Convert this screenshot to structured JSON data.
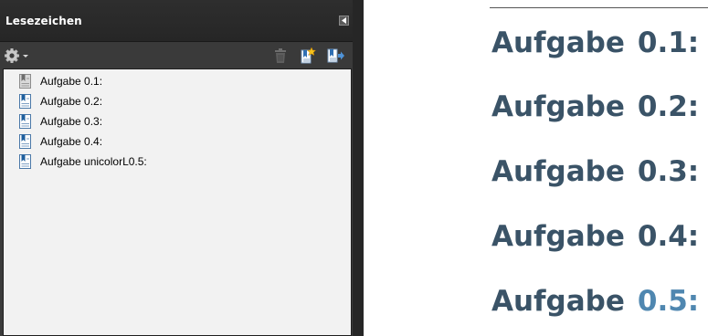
{
  "panel": {
    "title": "Lesezeichen",
    "toolbar": {
      "options_icon": "gear-icon",
      "delete_icon": "trash-icon",
      "new_bookmark_icon": "new-bookmark-icon",
      "expand_icon": "expand-bookmark-icon"
    },
    "bookmarks": [
      {
        "label": "Aufgabe 0.1:",
        "icon": "bookmark-icon",
        "selected": true
      },
      {
        "label": "Aufgabe 0.2:",
        "icon": "bookmark-icon"
      },
      {
        "label": "Aufgabe 0.3:",
        "icon": "bookmark-icon"
      },
      {
        "label": "Aufgabe 0.4:",
        "icon": "bookmark-icon"
      },
      {
        "label": "Aufgabe unicolorL0.5:",
        "icon": "bookmark-icon"
      }
    ]
  },
  "document": {
    "headings": [
      {
        "word": "Aufgabe",
        "number": "0.1:"
      },
      {
        "word": "Aufgabe",
        "number": "0.2:"
      },
      {
        "word": "Aufgabe",
        "number": "0.3:"
      },
      {
        "word": "Aufgabe",
        "number": "0.4:"
      },
      {
        "word": "Aufgabe",
        "number": "0.5:"
      }
    ]
  },
  "colors": {
    "heading_text": "#3a5367",
    "highlight_number": "#4f87b0",
    "panel_background": "#3b3b3b",
    "tree_background": "#f2f2f2"
  }
}
